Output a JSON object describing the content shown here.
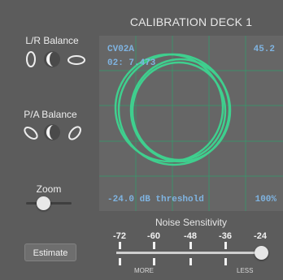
{
  "title": "CALIBRATION DECK 1",
  "lr_balance": {
    "label": "L/R Balance"
  },
  "pa_balance": {
    "label": "P/A Balance"
  },
  "zoom": {
    "label": "Zoom",
    "value": 0.25
  },
  "scope": {
    "top_left": "CV02A",
    "top_right": "45.2",
    "sub_left": "02: 7.473",
    "bottom_left": "-24.0 dB threshold",
    "bottom_right": "100%",
    "trace_color": "#3fcf8e",
    "grid_color": "#3f8f6a"
  },
  "noise": {
    "label": "Noise Sensitivity",
    "ticks": [
      "-72",
      "-60",
      "-48",
      "-36",
      "-24"
    ],
    "left_end": "MORE",
    "right_end": "LESS",
    "value": "-24"
  },
  "estimate_button": {
    "label": "Estimate"
  }
}
